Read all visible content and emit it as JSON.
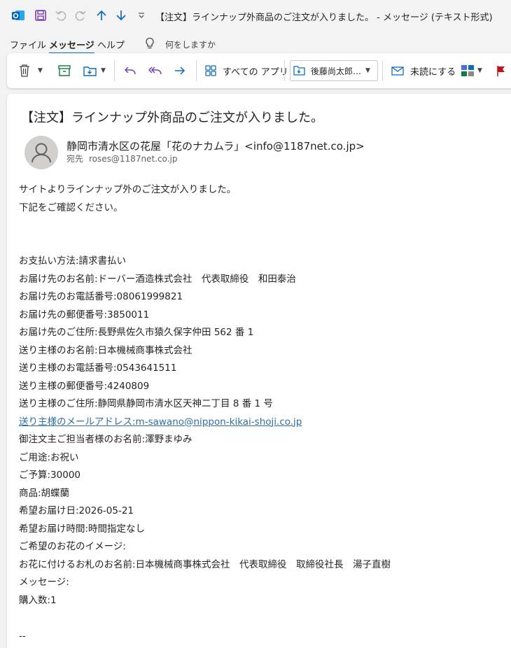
{
  "window": {
    "title": "【注文】ラインナップ外商品のご注文が入りました。 - メッセージ (テキスト形式)"
  },
  "menu": {
    "items": [
      "ファイル",
      "メッセージ",
      "ヘルプ"
    ],
    "search_prompt": "何をしますか"
  },
  "ribbon": {
    "all_apps_label": "すべての アプリ",
    "move_to_label": "後藤尚太郎…",
    "mark_unread_label": "未読にする"
  },
  "colors": {
    "accent": "#0f6cbd",
    "outlook_blue": "#0364b8",
    "link": "#2f6f9f",
    "flag_red": "#c50f1f"
  },
  "message": {
    "subject": "【注文】ラインナップ外商品のご注文が入りました。",
    "sender": "静岡市清水区の花屋「花のナカムラ」<info@1187net.co.jp>",
    "to_label": "宛先",
    "to_address": "roses@1187net.co.jp",
    "body_lines": [
      "サイトよりラインナップ外のご注文が入りました。",
      "下記をご確認ください。",
      "",
      "",
      "お支払い方法:請求書払い",
      "お届け先のお名前:ドーバー酒造株式会社　代表取締役　和田泰治",
      "お届け先のお電話番号:08061999821",
      "お届け先の郵便番号:3850011",
      "お届け先のご住所:長野県佐久市猿久保字仲田 562 番 1",
      "送り主様のお名前:日本機械商事株式会社",
      "送り主様のお電話番号:0543641511",
      "送り主様の郵便番号:4240809",
      "送り主様のご住所:静岡県静岡市清水区天神二丁目 8 番 1 号",
      "送り主様のメールアドレス:m-sawano@nippon-kikai-shoji.co.jp",
      "御注文主ご担当者様のお名前:澤野まゆみ",
      "ご用途:お祝い",
      "ご予算:30000",
      "商品:胡蝶蘭",
      "希望お届け日:2026-05-21",
      "希望お届け時間:時間指定なし",
      "ご希望のお花のイメージ:",
      "お花に付けるお札のお名前:日本機械商事株式会社　代表取締役　取締役社長　湯子直樹",
      "メッセージ:",
      "購入数:1",
      "",
      "--"
    ]
  }
}
